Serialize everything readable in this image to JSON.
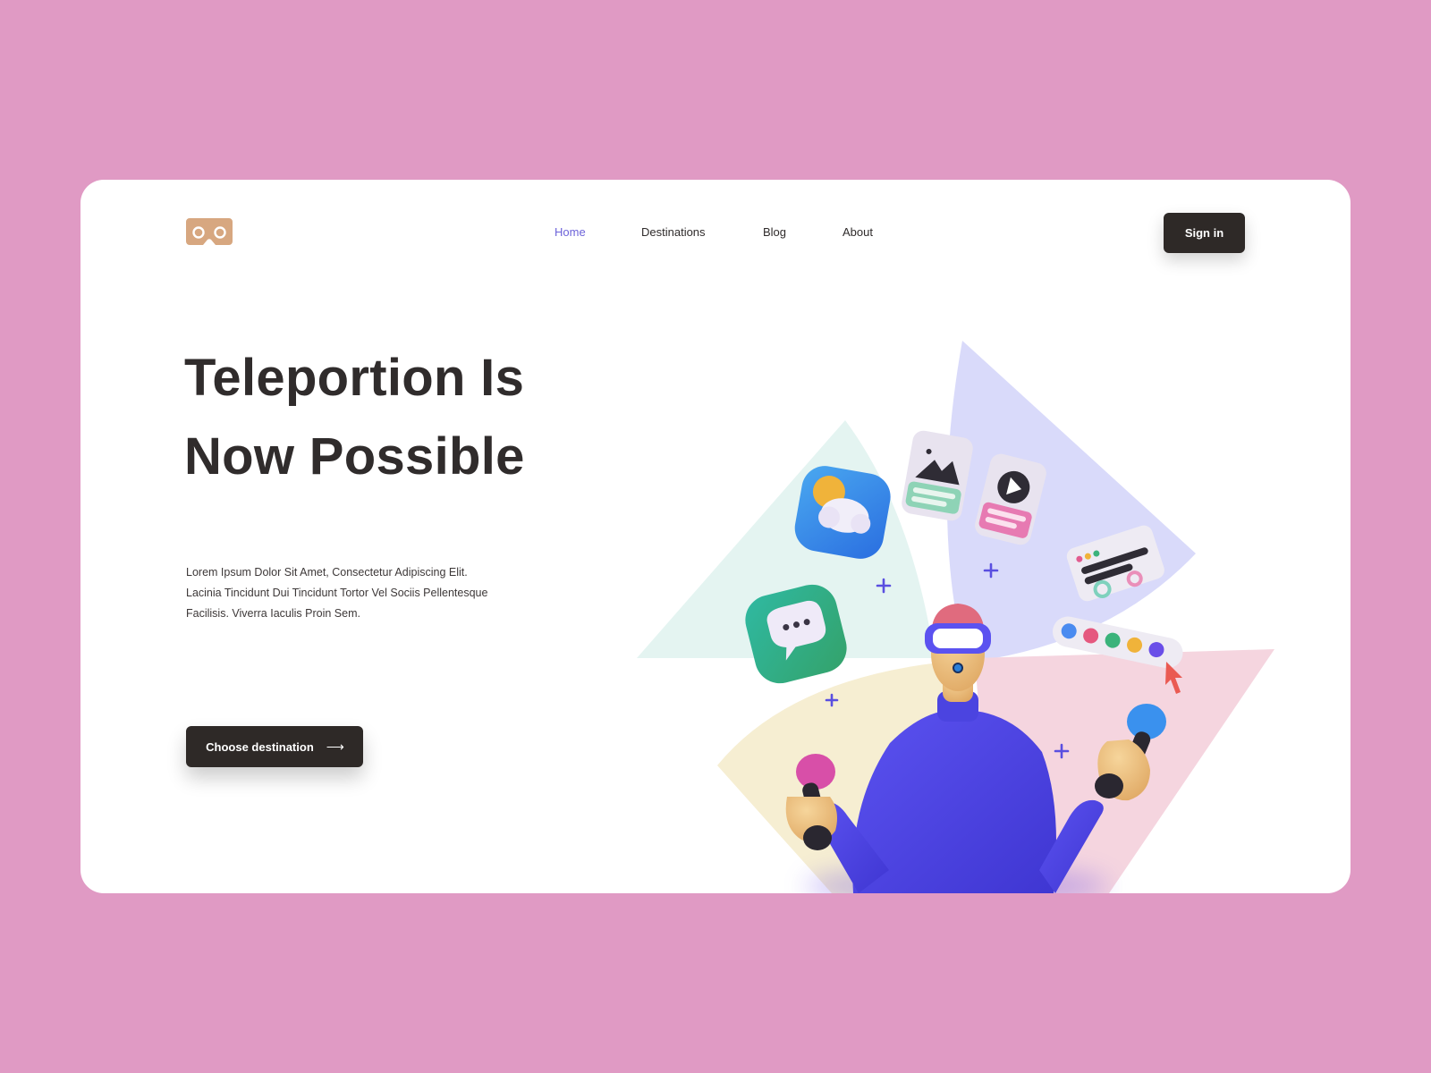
{
  "colors": {
    "background": "#e09ac4",
    "card": "#ffffff",
    "dark_button": "#2e2927",
    "accent": "#6d63d9",
    "logo": "#d7a780",
    "figure_blue": "#4b44e0"
  },
  "nav": {
    "items": [
      {
        "label": "Home",
        "active": true
      },
      {
        "label": "Destinations",
        "active": false
      },
      {
        "label": "Blog",
        "active": false
      },
      {
        "label": "About",
        "active": false
      }
    ],
    "signin_label": "Sign in"
  },
  "hero": {
    "headline_line1": "Teleportion Is",
    "headline_line2": "Now Possible",
    "description": "Lorem Ipsum Dolor Sit Amet, Consectetur Adipiscing Elit. Lacinia Tincidunt Dui Tincidunt Tortor Vel Sociis Pellentesque Facilisis. Viverra Iaculis Proin Sem.",
    "cta_label": "Choose destination",
    "cta_arrow": "⟶"
  },
  "illustration": {
    "subject": "vr-person-with-controllers",
    "icons": [
      "weather-icon",
      "chat-icon",
      "image-card-icon",
      "video-card-icon",
      "settings-card-icon",
      "color-palette-icon",
      "cursor-icon",
      "plus-icon"
    ]
  }
}
